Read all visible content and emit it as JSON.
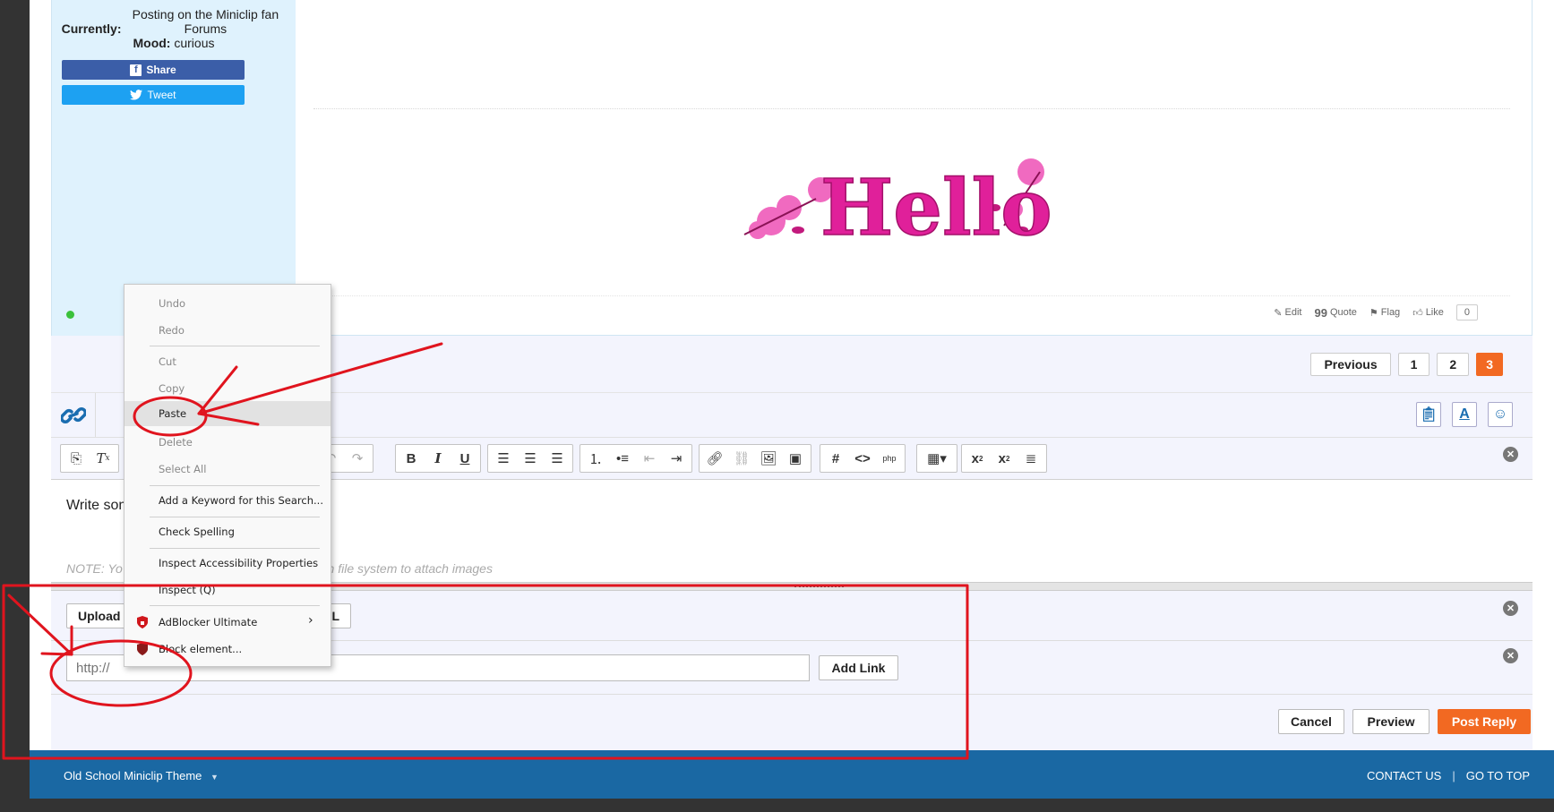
{
  "post": {
    "currently_label": "Currently:",
    "currently_value": "Posting on the Miniclip fan Forums",
    "mood_label": "Mood:",
    "mood_value": "curious",
    "share_label": "Share",
    "tweet_label": "Tweet",
    "hello_text": "Hello",
    "actions": {
      "edit": "Edit",
      "quote": "Quote",
      "flag": "Flag",
      "like": "Like",
      "like_count": "0"
    }
  },
  "pagination": {
    "previous": "Previous",
    "pages": [
      "1",
      "2",
      "3"
    ],
    "current": "3"
  },
  "editor": {
    "body_placeholder": "Write som",
    "note": "NOTE: Yo",
    "note_tail": "re from file system to attach images",
    "upload_label": "Upload",
    "url_tail": "L",
    "url_placeholder": "http://",
    "add_link": "Add Link"
  },
  "form_actions": {
    "cancel": "Cancel",
    "preview": "Preview",
    "post_reply": "Post Reply"
  },
  "footer": {
    "theme": "Old School Miniclip Theme",
    "theme_caret": "▼",
    "contact": "CONTACT US",
    "separator": "|",
    "go_top": "GO TO TOP"
  },
  "context_menu": {
    "undo": "Undo",
    "redo": "Redo",
    "cut": "Cut",
    "copy": "Copy",
    "paste": "Paste",
    "delete": "Delete",
    "select_all": "Select All",
    "add_keyword": "Add a Keyword for this Search...",
    "check_spelling": "Check Spelling",
    "inspect_accessibility": "Inspect Accessibility Properties",
    "inspect": "Inspect (Q)",
    "adblocker": "AdBlocker Ultimate",
    "block_element": "Block element..."
  },
  "colors": {
    "accent_orange": "#f26922",
    "footer_blue": "#1a68a3",
    "annotation_red": "#e0141e",
    "share_blue": "#3b5ea8",
    "tweet_blue": "#1da1f2"
  }
}
